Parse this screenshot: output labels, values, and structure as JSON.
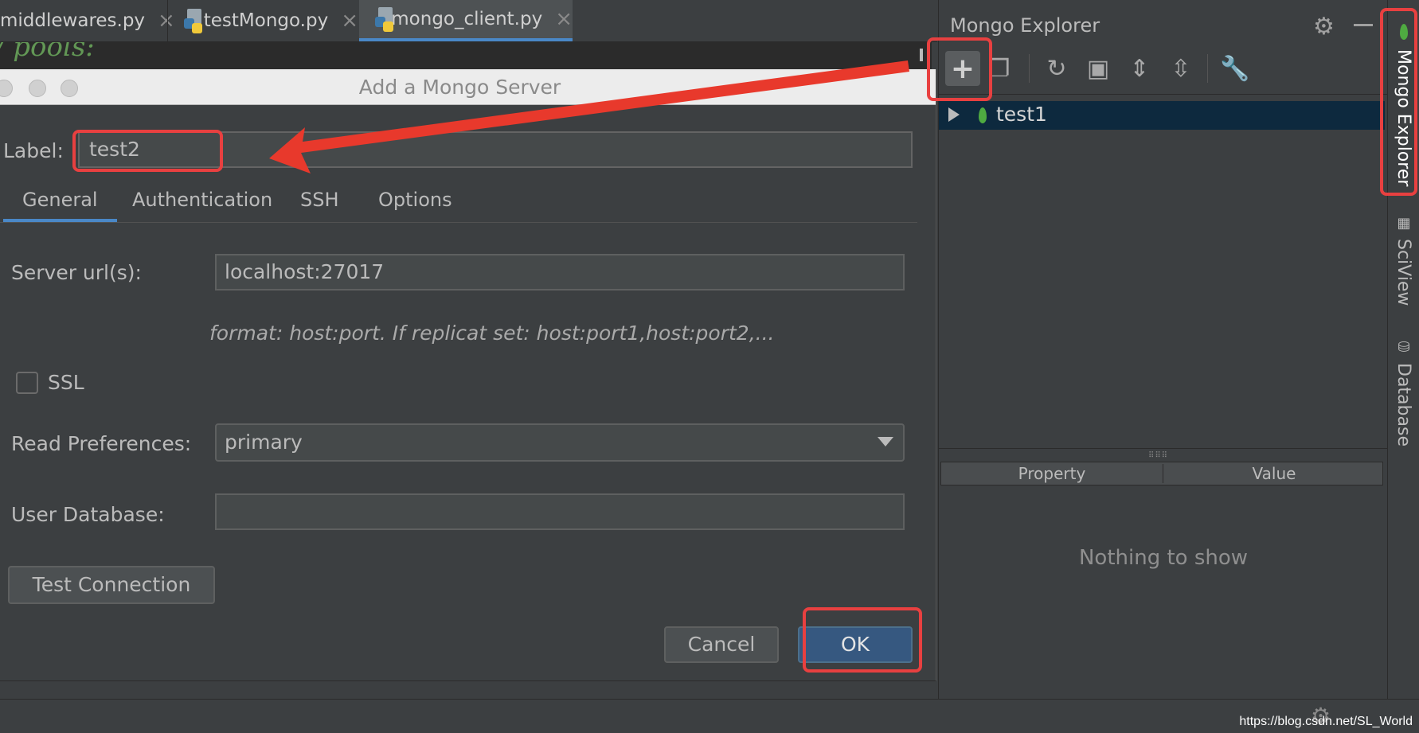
{
  "tabs": [
    {
      "name": "middlewares.py",
      "close": "×"
    },
    {
      "name": "testMongo.py",
      "close": "×"
    },
    {
      "name": "mongo_client.py",
      "close": "×"
    }
  ],
  "editor": {
    "code_fragment": "/ pools:"
  },
  "dialog": {
    "title": "Add a Mongo Server",
    "label_text": "Label:",
    "label_value": "test2",
    "tabs": [
      "General",
      "Authentication",
      "SSH",
      "Options"
    ],
    "server_url_label": "Server url(s):",
    "server_url_value": "localhost:27017",
    "format_hint": "format: host:port. If replicat set: host:port1,host:port2,...",
    "ssl_label": "SSL",
    "read_pref_label": "Read  Preferences:",
    "read_pref_value": "primary",
    "user_db_label": "User Database:",
    "user_db_value": "",
    "test_connection": "Test Connection",
    "cancel": "Cancel",
    "ok": "OK"
  },
  "explorer": {
    "title": "Mongo Explorer",
    "tree": [
      {
        "name": "test1"
      }
    ],
    "columns": [
      "Property",
      "Value"
    ],
    "empty_text": "Nothing to show"
  },
  "sidebar_tabs": [
    "Mongo Explorer",
    "SciView",
    "Database"
  ],
  "watermark": "https://blog.csdn.net/SL_World",
  "colors": {
    "accent": "#4a88c7",
    "highlight": "#e84040",
    "mongo_leaf": "#4faa41",
    "primary_button": "#365880"
  }
}
